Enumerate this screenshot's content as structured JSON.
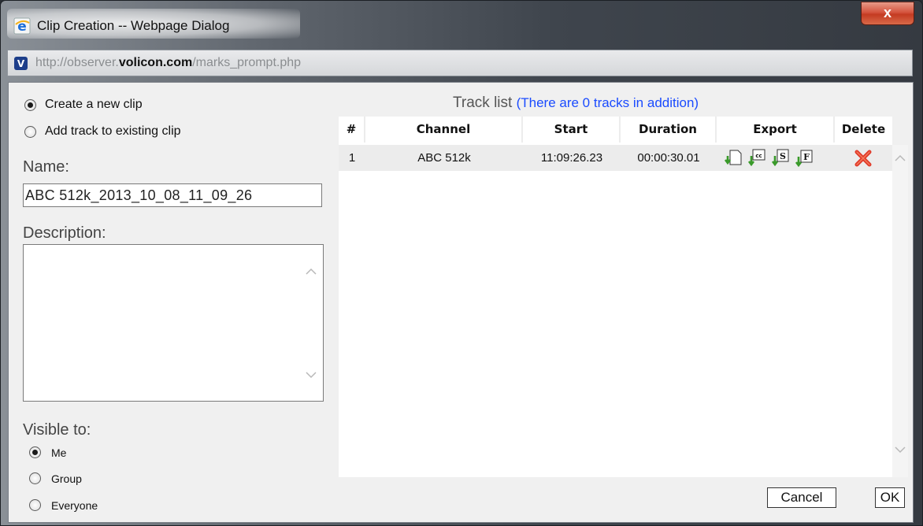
{
  "window": {
    "title": "Clip Creation -- Webpage Dialog",
    "close_label": "x",
    "address": {
      "prefix": "http://observer.",
      "domain": "volicon.com",
      "path": "/marks_prompt.php"
    }
  },
  "clip_mode": {
    "options": [
      {
        "label": "Create a new clip",
        "checked": true
      },
      {
        "label": "Add track to existing clip",
        "checked": false
      }
    ]
  },
  "name": {
    "label": "Name:",
    "value": "ABC 512k_2013_10_08_11_09_26"
  },
  "description": {
    "label": "Description:",
    "value": ""
  },
  "visibility": {
    "label": "Visible to:",
    "options": [
      {
        "label": "Me",
        "checked": true
      },
      {
        "label": "Group",
        "checked": false
      },
      {
        "label": "Everyone",
        "checked": false
      }
    ]
  },
  "track_list": {
    "title": "Track list",
    "note": "(There are 0 tracks in addition)",
    "columns": [
      "#",
      "Channel",
      "Start",
      "Duration",
      "Export",
      "Delete"
    ],
    "rows": [
      {
        "num": "1",
        "channel": "ABC 512k",
        "start": "11:09:26.23",
        "duration": "00:00:30.01",
        "export_icons": [
          "export-file-icon",
          "export-cc-icon",
          "export-s-icon",
          "export-f-icon"
        ],
        "delete_icon": "delete-x-icon"
      }
    ]
  },
  "buttons": {
    "cancel": "Cancel",
    "ok": "OK"
  },
  "colors": {
    "link_blue": "#1a4bff",
    "delete_red": "#e03a2a",
    "export_green": "#3a9a2a"
  }
}
